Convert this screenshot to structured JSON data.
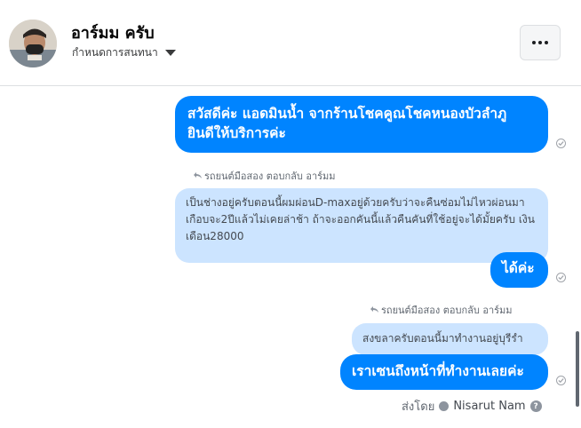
{
  "header": {
    "contact_name": "อาร์มม ครับ",
    "settings_label": "กำหนดการสนทนา",
    "more_icon": "more-horizontal-icon"
  },
  "messages": {
    "greeting": "สวัสดีค่ะ แอดมินน้ำ จากร้านโชคคูณโชคหนองบัวลำภู ยินดีให้บริการค่ะ",
    "reply1_label": "รถยนต์มือสอง ตอบกลับ อาร์มม",
    "reply1_quote": "เป็นช่างอยู่ครับตอนนี้ผมผ่อนD-maxอยู่ด้วยครับว่าจะคืนซ่อมไม่ไหวผ่อนมาเกือบจะ2ปีแล้วไม่เคยล่าช้า ถ้าจะออกคันนี้แล้วคืนคันที่ใช้อยู่จะได้มั้ยครับ เงินเดือน28000",
    "reply1_answer": "ได้ค่ะ",
    "reply2_label": "รถยนต์มือสอง ตอบกลับ อาร์มม",
    "reply2_quote": "สงขลาครับตอนนี้มาทำงานอยู่บุรีรำ",
    "reply2_answer": "เราเซนถึงหน้าที่ทำงานเลยค่ะ"
  },
  "footer": {
    "sent_by_label": "ส่งโดย",
    "sender_name": "Nisarut Nam"
  },
  "colors": {
    "accent": "#0084ff",
    "reply_bg": "#cce4ff"
  }
}
